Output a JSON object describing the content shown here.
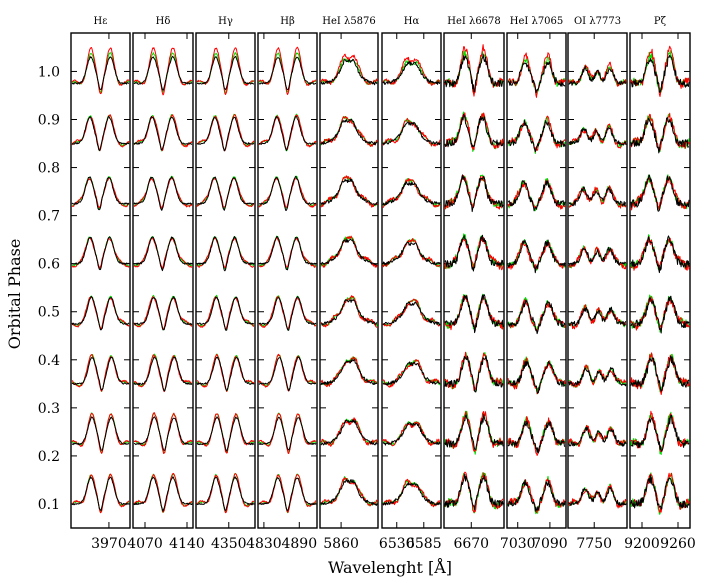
{
  "figure": {
    "ylabel": "Orbital Phase",
    "xlabel": "Wavelenght [Å]"
  },
  "chart_data": {
    "type": "line",
    "ylabel": "Orbital Phase",
    "xlabel": "Wavelenght [Å]",
    "ylim": [
      0.05,
      1.08
    ],
    "yticks": [
      0.1,
      0.2,
      0.3,
      0.4,
      0.5,
      0.6,
      0.7,
      0.8,
      0.9,
      1.0
    ],
    "phases": [
      0.1,
      0.225,
      0.35,
      0.475,
      0.6,
      0.725,
      0.85,
      0.975
    ],
    "series_colors": {
      "observed": "#000000",
      "model_a": "#ff0000",
      "model_b": "#00dd00"
    },
    "panels": [
      {
        "title": "Hε",
        "xlim": [
          3925,
          3995
        ],
        "xticks": [
          3970
        ],
        "profile": "double",
        "sep": 0.17,
        "amp": 1.0,
        "noise": 0.01
      },
      {
        "title": "Hδ",
        "xlim": [
          4050,
          4150
        ],
        "xticks": [
          4070,
          4140
        ],
        "profile": "double",
        "sep": 0.17,
        "amp": 1.0,
        "noise": 0.01
      },
      {
        "title": "Hγ",
        "xlim": [
          4300,
          4390
        ],
        "xticks": [
          4350
        ],
        "profile": "double",
        "sep": 0.17,
        "amp": 1.0,
        "noise": 0.01
      },
      {
        "title": "Hβ",
        "xlim": [
          4820,
          4920
        ],
        "xticks": [
          4830,
          4890
        ],
        "profile": "double",
        "sep": 0.17,
        "amp": 1.0,
        "noise": 0.01
      },
      {
        "title": "HeI λ5876",
        "xlim": [
          5820,
          5930
        ],
        "xticks": [
          5860
        ],
        "profile": "broad",
        "sep": 0.12,
        "amp": 0.85,
        "noise": 0.02
      },
      {
        "title": "Hα",
        "xlim": [
          6500,
          6620
        ],
        "xticks": [
          6530,
          6585
        ],
        "profile": "broad",
        "sep": 0.12,
        "amp": 0.75,
        "noise": 0.02
      },
      {
        "title": "HeI λ6678",
        "xlim": [
          6620,
          6730
        ],
        "xticks": [
          6670
        ],
        "profile": "double",
        "sep": 0.16,
        "amp": 1.0,
        "noise": 0.045
      },
      {
        "title": "HeI λ7065",
        "xlim": [
          7010,
          7120
        ],
        "xticks": [
          7030,
          7090
        ],
        "profile": "double",
        "sep": 0.2,
        "amp": 0.8,
        "noise": 0.04
      },
      {
        "title": "OI λ7773",
        "xlim": [
          7710,
          7800
        ],
        "xticks": [
          7750
        ],
        "profile": "triple",
        "sep": 0.22,
        "amp": 0.7,
        "noise": 0.03
      },
      {
        "title": "Pζ",
        "xlim": [
          9180,
          9280
        ],
        "xticks": [
          9200,
          9260
        ],
        "profile": "double",
        "sep": 0.17,
        "amp": 0.95,
        "noise": 0.05
      }
    ]
  }
}
